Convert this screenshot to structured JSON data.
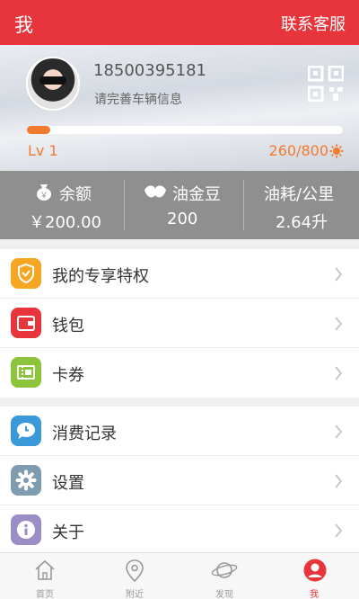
{
  "header": {
    "title": "我",
    "contact": "联系客服"
  },
  "profile": {
    "phone": "18500395181",
    "hint": "请完善车辆信息",
    "level": "Lv 1",
    "points": "260/800",
    "progress": 0.075
  },
  "stats": [
    {
      "label": "余额",
      "value": "￥200.00",
      "icon": "money-bag-icon"
    },
    {
      "label": "油金豆",
      "value": "200",
      "icon": "bean-icon"
    },
    {
      "label": "油耗/公里",
      "value": "2.64升"
    }
  ],
  "menu": {
    "group1": [
      {
        "label": "我的专享特权",
        "icon": "shield-icon",
        "color": "#f5a623"
      },
      {
        "label": "钱包",
        "icon": "wallet-icon",
        "color": "#e8353b"
      },
      {
        "label": "卡券",
        "icon": "coupon-icon",
        "color": "#8cc43c"
      }
    ],
    "group2": [
      {
        "label": "消费记录",
        "icon": "chat-bubble-icon",
        "color": "#3a9ad9"
      },
      {
        "label": "设置",
        "icon": "gear-icon",
        "color": "#7f9bb0"
      },
      {
        "label": "关于",
        "icon": "info-icon",
        "color": "#9b8ec4"
      }
    ]
  },
  "tabs": [
    {
      "label": "首页",
      "icon": "home-icon"
    },
    {
      "label": "附近",
      "icon": "location-pin-icon"
    },
    {
      "label": "发现",
      "icon": "planet-icon"
    },
    {
      "label": "我",
      "icon": "user-icon",
      "active": true
    }
  ],
  "colors": {
    "brand": "#e8353b",
    "accent": "#f07a2e"
  }
}
